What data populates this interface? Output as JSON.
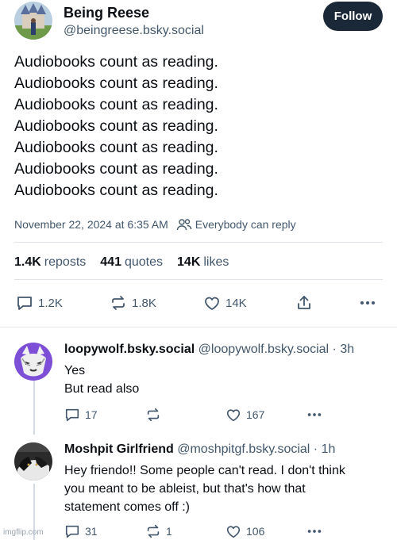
{
  "post": {
    "author_name": "Being Reese",
    "author_handle": "@beingreese.bsky.social",
    "follow_label": "Follow",
    "text_lines": [
      "Audiobooks count as reading.",
      "Audiobooks count as reading.",
      "Audiobooks count as reading.",
      "Audiobooks count as reading.",
      "Audiobooks count as reading.",
      "Audiobooks count as reading.",
      "Audiobooks count as reading."
    ],
    "timestamp": "November 22, 2024 at 6:35 AM",
    "reply_setting": "Everybody can reply",
    "stats": {
      "reposts_count": "1.4K",
      "reposts_label": "reposts",
      "quotes_count": "441",
      "quotes_label": "quotes",
      "likes_count": "14K",
      "likes_label": "likes"
    },
    "actions": {
      "replies": "1.2K",
      "reposts": "1.8K",
      "likes": "14K"
    }
  },
  "replies": [
    {
      "name": "loopywolf.bsky.social",
      "handle_time": "@loopywolf.bsky.social · 3h",
      "text_lines": [
        "Yes",
        "But read also"
      ],
      "actions": {
        "replies": "17",
        "reposts": "",
        "likes": "167"
      }
    },
    {
      "name": "Moshpit Girlfriend",
      "handle_time": "@moshpitgf.bsky.social · 1h",
      "text_lines": [
        "Hey friendo!! Some people can't read. I don't think",
        "you meant to be ableist, but that's how that",
        "statement comes off :)"
      ],
      "actions": {
        "replies": "31",
        "reposts": "1",
        "likes": "106"
      }
    }
  ],
  "watermark": "imgflip.com",
  "icons": {
    "reply_setting": "people-icon",
    "reply": "speech-bubble-icon",
    "repost": "repost-arrows-icon",
    "like": "heart-icon",
    "share": "share-up-arrow-icon",
    "more": "ellipsis-icon"
  },
  "colors": {
    "text": "#0b0f14",
    "muted": "#42576c",
    "follow_bg": "#1b2837",
    "divider": "#dfe3e8"
  }
}
